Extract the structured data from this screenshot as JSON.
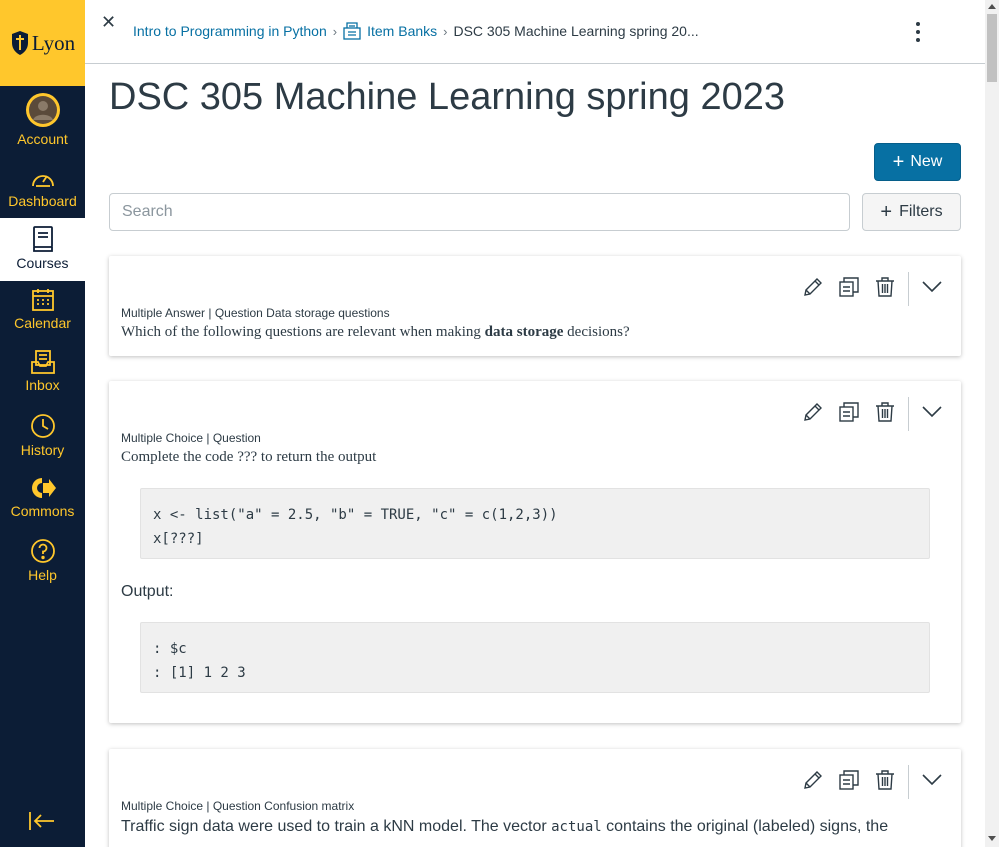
{
  "brand": {
    "logo_text": "Lyon",
    "colors": {
      "nav_bg": "#0c1d36",
      "nav_fg": "#ffc72c",
      "accent": "#0770a3"
    }
  },
  "global_nav": [
    {
      "label": "Account",
      "icon": "avatar"
    },
    {
      "label": "Dashboard",
      "icon": "dashboard-icon"
    },
    {
      "label": "Courses",
      "icon": "courses-icon",
      "active": true
    },
    {
      "label": "Calendar",
      "icon": "calendar-icon"
    },
    {
      "label": "Inbox",
      "icon": "inbox-icon"
    },
    {
      "label": "History",
      "icon": "history-icon"
    },
    {
      "label": "Commons",
      "icon": "commons-icon"
    },
    {
      "label": "Help",
      "icon": "help-icon"
    }
  ],
  "breadcrumb": {
    "course": "Intro to Programming in Python",
    "item_banks": "Item Banks",
    "current": "DSC 305 Machine Learning spring 20..."
  },
  "page": {
    "title": "DSC 305 Machine Learning spring 2023",
    "new_label": "New",
    "search_placeholder": "Search",
    "filters_label": "Filters"
  },
  "questions": [
    {
      "meta": "Multiple Answer | Question Data storage questions",
      "text_before": "Which of the following questions are relevant when making ",
      "text_bold": "data storage",
      "text_after": " decisions?"
    },
    {
      "meta": "Multiple Choice | Question",
      "text": "Complete the code ??? to return the output",
      "code1": "x <- list(\"a\" = 2.5, \"b\" = TRUE, \"c\" = c(1,2,3))\nx[???]",
      "output_label": "Output:",
      "code2": ": $c\n: [1] 1 2 3"
    },
    {
      "meta": "Multiple Choice | Question Confusion matrix",
      "text_before": "Traffic sign data were used to train a kNN model. The vector ",
      "text_code": "actual",
      "text_after": " contains the original (labeled) signs, the"
    }
  ]
}
